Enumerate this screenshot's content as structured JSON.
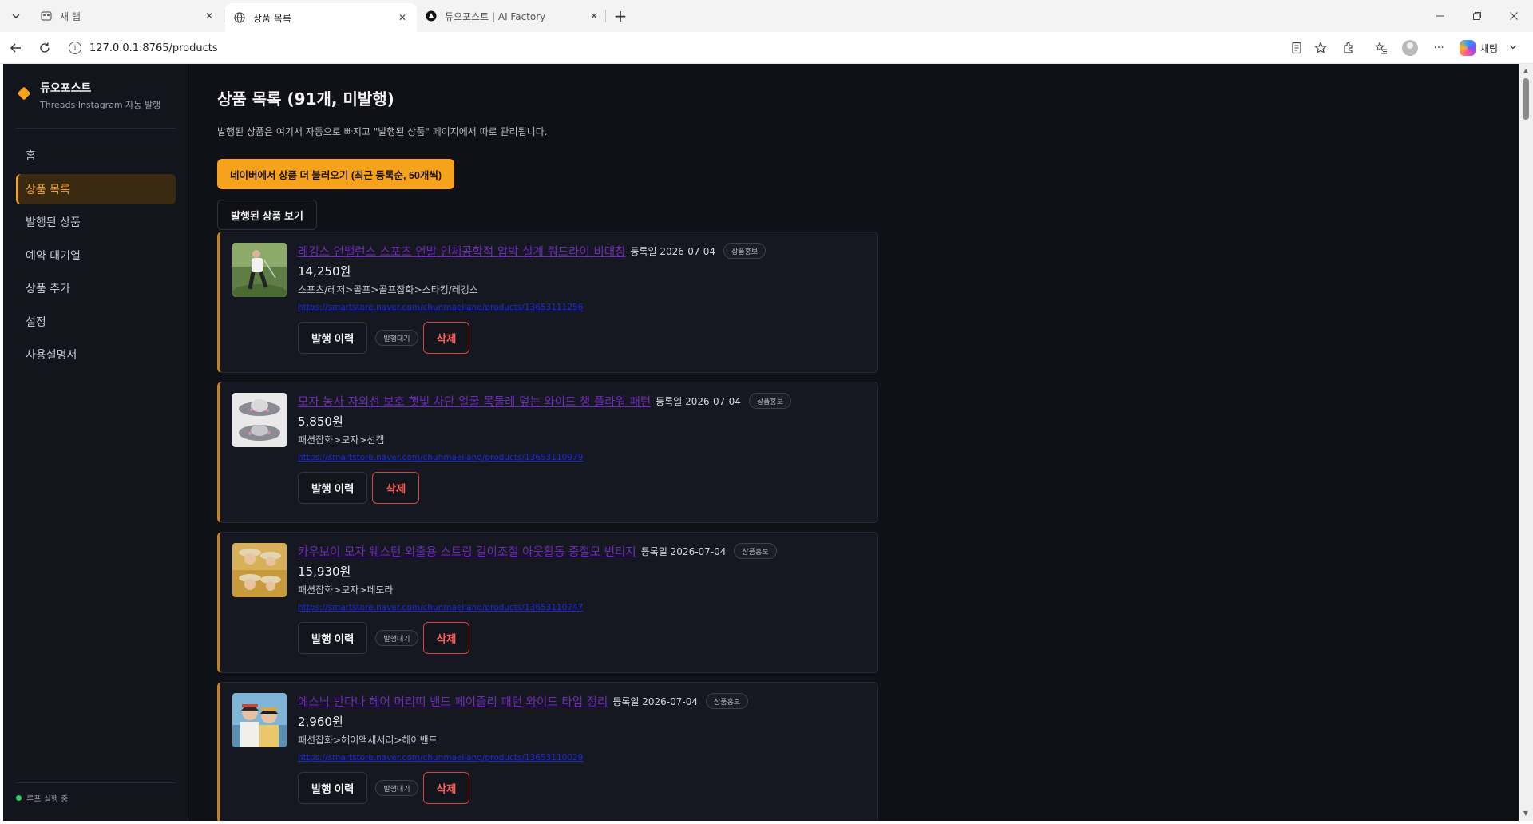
{
  "browser": {
    "tabs": [
      {
        "title": "새 탭",
        "state": "inactive",
        "icon": "new-tab-icon"
      },
      {
        "title": "상품 목록",
        "state": "active",
        "icon": "globe-icon"
      },
      {
        "title": "듀오포스트 | AI Factory",
        "state": "inactive",
        "icon": "ai-factory-icon"
      }
    ],
    "url_host": "127.0.0.1",
    "url_rest": ":8765/products",
    "chat_label": "채팅"
  },
  "sidebar": {
    "brand_title": "듀오포스트",
    "brand_subtitle": "Threads·Instagram 자동 발행",
    "items": [
      {
        "label": "홈"
      },
      {
        "label": "상품 목록",
        "active": true
      },
      {
        "label": "발행된 상품"
      },
      {
        "label": "예약 대기열"
      },
      {
        "label": "상품 추가"
      },
      {
        "label": "설정"
      },
      {
        "label": "사용설명서"
      }
    ],
    "loop_status": "루프 실행 중"
  },
  "main": {
    "title": "상품 목록 (91개, 미발행)",
    "description": "발행된 상품은 여기서 자동으로 빠지고 \"발행된 상품\" 페이지에서 따로 관리됩니다.",
    "load_button": "네이버에서 상품 더 불러오기 (최근 등록순, 50개씩)",
    "published_button": "발행된 상품 보기",
    "products": [
      {
        "name": "레깅스 언밸런스 스포츠 언발 인체공학적 압박 설계 쿼드라이 비대칭",
        "reg_label": "등록일 2026-07-04",
        "tag": "상품홍보",
        "price": "14,250원",
        "category": "스포츠/레저>골프>골프잡화>스타킹/레깅스",
        "url": "https://smartstore.naver.com/chunmaeilang/products/13653111256",
        "history_label": "발행 이력",
        "status": "발행대기",
        "delete_label": "삭제"
      },
      {
        "name": "모자 농사 자외선 보호 햇빛 차단 얼굴 목둘레 덮는 와이드 챙 플라워 패턴",
        "reg_label": "등록일 2026-07-04",
        "tag": "상품홍보",
        "price": "5,850원",
        "category": "패션잡화>모자>선캡",
        "url": "https://smartstore.naver.com/chunmaeilang/products/13653110979",
        "history_label": "발행 이력",
        "status": "",
        "delete_label": "삭제"
      },
      {
        "name": "카우보이 모자 웨스턴 외출용 스트링 길이조절 아웃활동 중절모 빈티지",
        "reg_label": "등록일 2026-07-04",
        "tag": "상품홍보",
        "price": "15,930원",
        "category": "패션잡화>모자>페도라",
        "url": "https://smartstore.naver.com/chunmaeilang/products/13653110747",
        "history_label": "발행 이력",
        "status": "발행대기",
        "delete_label": "삭제"
      },
      {
        "name": "에스닉 반다나 헤어 머리띠 밴드 페이즐리 패턴 와이드 타입 정리",
        "reg_label": "등록일 2026-07-04",
        "tag": "상품홍보",
        "price": "2,960원",
        "category": "패션잡화>헤어액세서리>헤어밴드",
        "url": "https://smartstore.naver.com/chunmaeilang/products/13653110029",
        "history_label": "발행 이력",
        "status": "발행대기",
        "delete_label": "삭제"
      }
    ]
  },
  "colors": {
    "accent": "#f7a21b",
    "background": "#0f1117",
    "sidebar": "#12151c",
    "card": "#151821",
    "link": "#6e2bb8",
    "danger": "#e0403f"
  }
}
